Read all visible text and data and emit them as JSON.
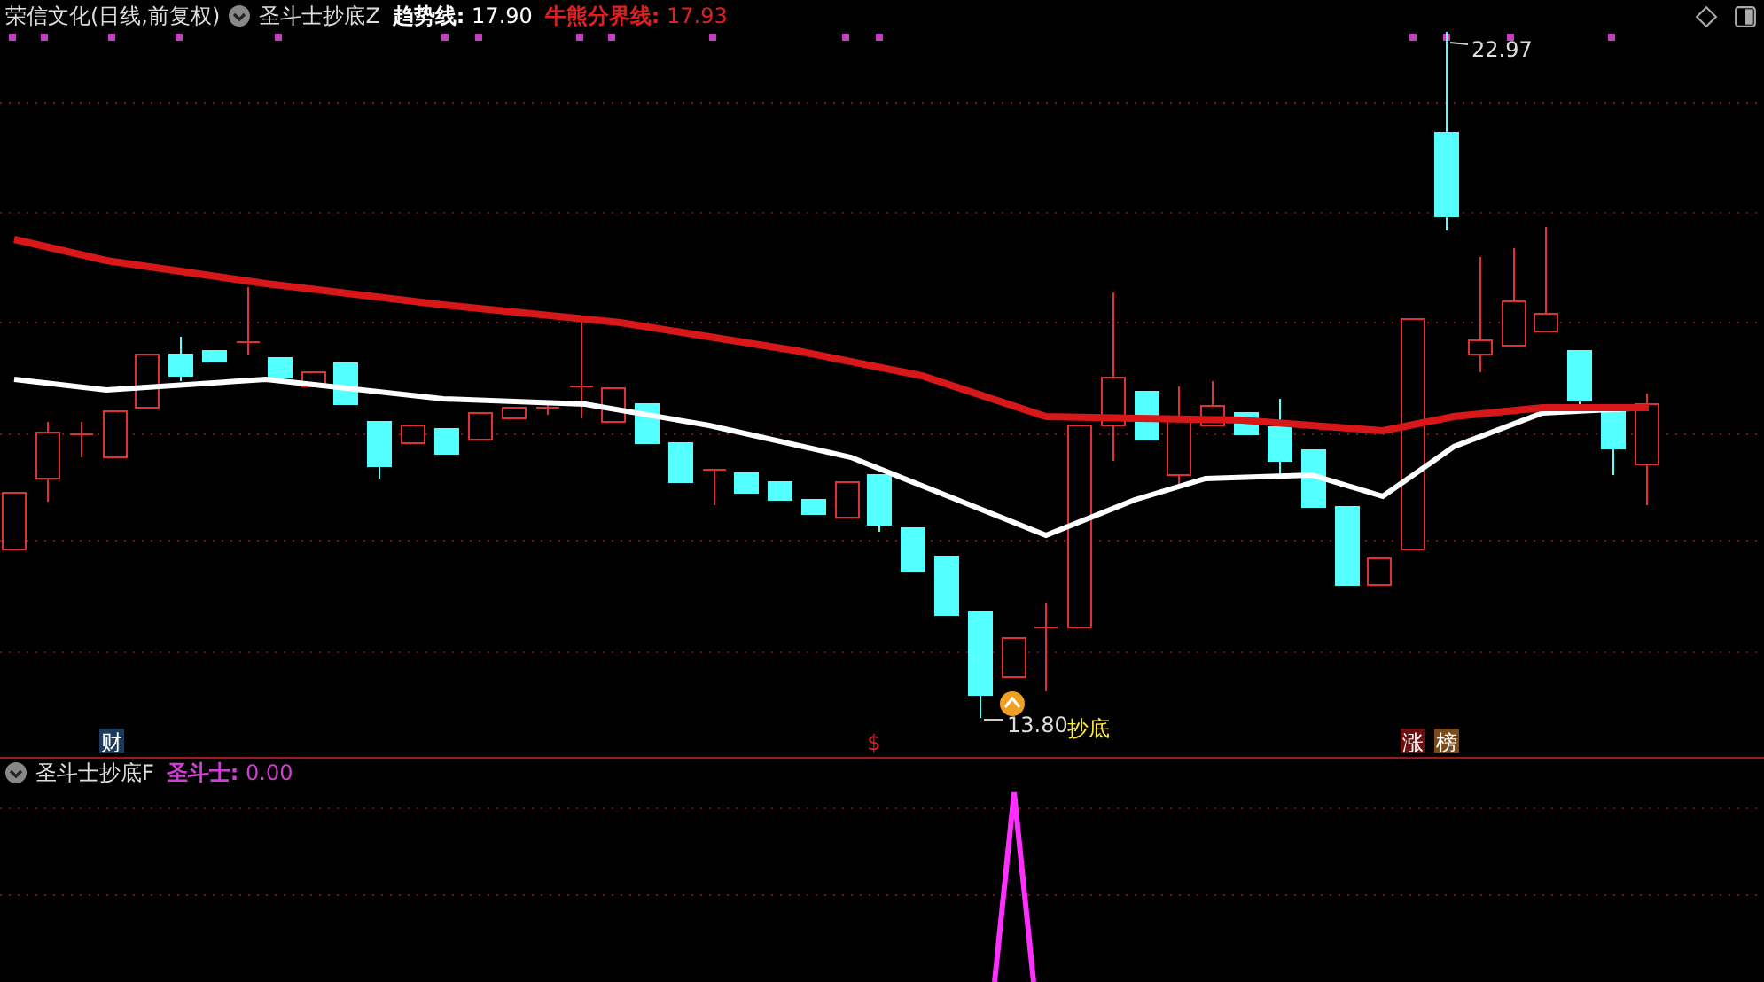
{
  "header": {
    "stock_title": "荣信文化(日线,前复权)",
    "indicator": "圣斗士抄底Z",
    "lines": [
      {
        "label": "趋势线:",
        "value": "17.90",
        "color": "#ffffff"
      },
      {
        "label": "牛熊分界线:",
        "value": "17.93",
        "color": "#e02020"
      }
    ]
  },
  "main_chart": {
    "high_label": "22.97",
    "low_label": "13.80",
    "signal_text": "抄底",
    "markers": [
      {
        "text": "财",
        "kind": "finance"
      },
      {
        "text": "$",
        "kind": "dollar"
      },
      {
        "text": "涨",
        "kind": "rise"
      },
      {
        "text": "榜",
        "kind": "list"
      }
    ]
  },
  "sub_panel": {
    "indicator": "圣斗士抄底F",
    "reading": {
      "label": "圣斗士:",
      "value": "0.00"
    }
  }
}
